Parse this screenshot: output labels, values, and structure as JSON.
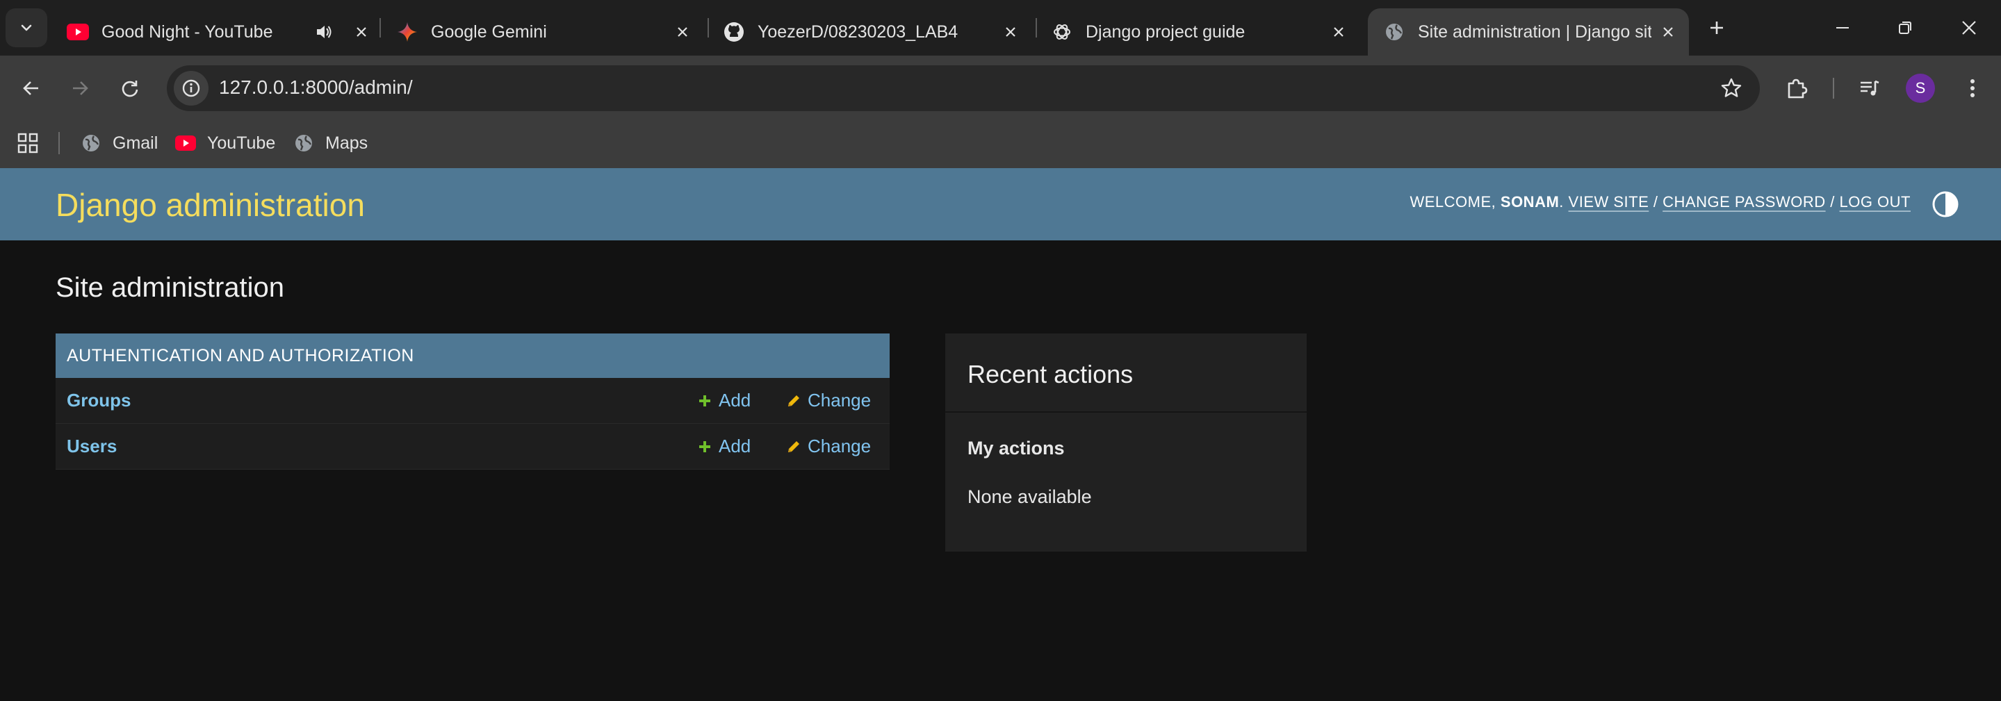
{
  "browser": {
    "tabs": [
      {
        "title": "Good Night - YouTube",
        "favicon": "youtube-icon",
        "audio": true
      },
      {
        "title": "Google Gemini",
        "favicon": "gemini-icon"
      },
      {
        "title": "YoezerD/08230203_LAB4",
        "favicon": "github-icon"
      },
      {
        "title": "Django project guide",
        "favicon": "chatgpt-icon"
      },
      {
        "title": "Site administration | Django site admin",
        "favicon": "globe-icon",
        "active": true
      }
    ],
    "url": "127.0.0.1:8000/admin/",
    "profile_initial": "S",
    "bookmarks": [
      {
        "label": "Gmail",
        "icon": "globe-icon"
      },
      {
        "label": "YouTube",
        "icon": "youtube-icon"
      },
      {
        "label": "Maps",
        "icon": "globe-icon"
      }
    ]
  },
  "header": {
    "branding": "Django administration",
    "welcome": "WELCOME,",
    "username": "SONAM",
    "view_site": "VIEW SITE",
    "change_password": "CHANGE PASSWORD",
    "log_out": "LOG OUT",
    "separator": "/"
  },
  "content": {
    "title": "Site administration",
    "modules": [
      {
        "caption": "AUTHENTICATION AND AUTHORIZATION",
        "models": [
          {
            "name": "Groups",
            "add": "Add",
            "change": "Change"
          },
          {
            "name": "Users",
            "add": "Add",
            "change": "Change"
          }
        ]
      }
    ],
    "recent": {
      "title": "Recent actions",
      "my_actions": "My actions",
      "none": "None available"
    }
  },
  "colors": {
    "header_bg": "#4f7894",
    "branding": "#f5dd5d",
    "link": "#7fc4ea",
    "add_icon": "#70bf2b",
    "change_icon": "#efb80b",
    "page_bg": "#121212"
  }
}
